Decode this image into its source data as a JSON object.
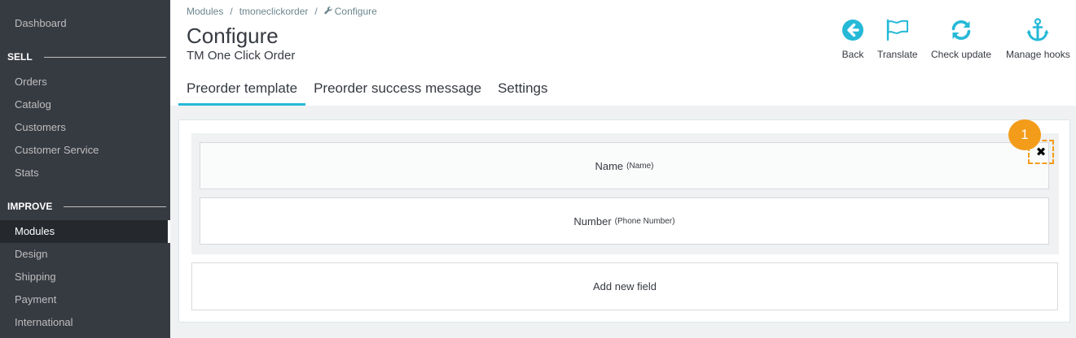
{
  "sidebar": {
    "dashboard": "Dashboard",
    "sell_title": "SELL",
    "orders": "Orders",
    "catalog": "Catalog",
    "customers": "Customers",
    "customer_service": "Customer Service",
    "stats": "Stats",
    "improve_title": "IMPROVE",
    "modules": "Modules",
    "design": "Design",
    "shipping": "Shipping",
    "payment": "Payment",
    "international": "International"
  },
  "breadcrumb": {
    "modules": "Modules",
    "sep": "/",
    "module": "tmoneclickorder",
    "current": "Configure"
  },
  "header": {
    "title": "Configure",
    "subtitle": "TM One Click Order"
  },
  "toolbar": {
    "back": "Back",
    "translate": "Translate",
    "check_update": "Check update",
    "manage_hooks": "Manage hooks"
  },
  "tabs": {
    "preorder_template": "Preorder template",
    "preorder_success": "Preorder success message",
    "settings": "Settings"
  },
  "fields": {
    "name_label": "Name",
    "name_sub": "(Name)",
    "number_label": "Number",
    "number_sub": "(Phone Number)",
    "add_new": "Add new field"
  },
  "annotation": {
    "marker": "1",
    "remove_icon": "✖"
  },
  "colors": {
    "sidebar": "#363a41",
    "accent": "#25b9d7",
    "highlight": "#f39c1a"
  },
  "icons": {
    "back": "arrow-circle-left-icon",
    "translate": "flag-icon",
    "check_update": "refresh-icon",
    "manage_hooks": "anchor-icon",
    "breadcrumb": "wrench-icon",
    "remove": "close-icon"
  }
}
